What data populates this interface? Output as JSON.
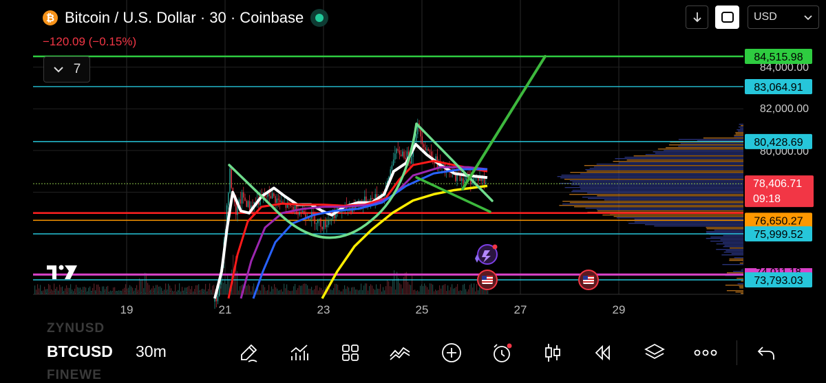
{
  "header": {
    "coin_glyph": "₿",
    "title": "Bitcoin / U.S. Dollar · 30 · Coinbase",
    "change": "−120.09 (−0.15%)",
    "indicator_count": "7",
    "currency": "USD"
  },
  "colors": {
    "up": "#26a69a",
    "down": "#f23645",
    "green_line": "#2ecc40",
    "cyan_line": "#26c6da",
    "red_line": "#ff2020",
    "orange_line": "#ff9800",
    "magenta_line": "#d941c8",
    "white_ma": "#ffffff",
    "red_ma": "#ff1a1a",
    "purple_ma": "#9c27b0",
    "blue_ma": "#2962ff",
    "yellow_ma": "#ffee00",
    "pattern_light": "#6fdc8c",
    "pattern_dark": "#3db83d"
  },
  "chart_data": {
    "type": "candlestick",
    "symbol": "BTCUSD",
    "interval": "30m",
    "x_ticks": [
      "19",
      "21",
      "23",
      "25",
      "27",
      "29"
    ],
    "y_ticks": [
      "84,000.00",
      "82,000.00",
      "80,000.00"
    ],
    "ylim": [
      72900,
      85700
    ],
    "levels": [
      {
        "label": "84,515.98",
        "value": 84515.98,
        "role": "green_line"
      },
      {
        "label": "83,064.91",
        "value": 83064.91,
        "role": "cyan_line"
      },
      {
        "label": "80,428.69",
        "value": 80428.69,
        "role": "cyan_line"
      },
      {
        "label": "78,406.71",
        "value": 78406.71,
        "role": "current"
      },
      {
        "label": "76,650.27",
        "value": 76650.27,
        "role": "orange_line"
      },
      {
        "label": "75,999.52",
        "value": 75999.52,
        "role": "cyan_line"
      },
      {
        "label": "73,793.03",
        "value": 73793.03,
        "role": "cyan_line"
      }
    ],
    "support_line": 77000,
    "magenta_line": 74050,
    "hidden_label": "74,011.18",
    "current_price": "78,406.71",
    "countdown": "09:18"
  },
  "toolbar": {
    "ghost_top": "ZYNUSD",
    "symbol": "BTCUSD",
    "timeframe": "30m",
    "ghost_bottom": "FINEWE"
  }
}
